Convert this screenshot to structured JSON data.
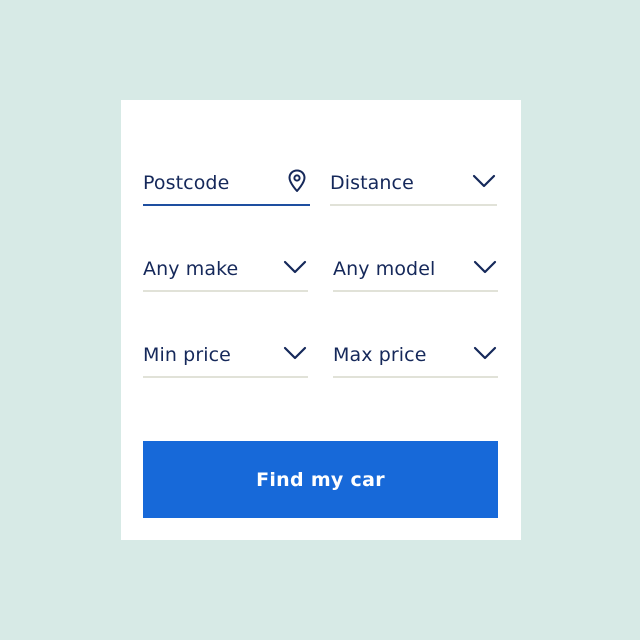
{
  "form": {
    "postcode": {
      "label": "Postcode",
      "icon": "map-pin-icon"
    },
    "distance": {
      "label": "Distance",
      "icon": "chevron-down-icon"
    },
    "make": {
      "label": "Any make",
      "icon": "chevron-down-icon"
    },
    "model": {
      "label": "Any model",
      "icon": "chevron-down-icon"
    },
    "min_price": {
      "label": "Min price",
      "icon": "chevron-down-icon"
    },
    "max_price": {
      "label": "Max price",
      "icon": "chevron-down-icon"
    },
    "submit_label": "Find my car"
  },
  "colors": {
    "page_background": "#d7eae6",
    "card_background": "#ffffff",
    "text": "#15285a",
    "active_underline": "#1e4fa0",
    "underline": "#e1e2d8",
    "button": "#1769d9",
    "button_text": "#ffffff"
  }
}
